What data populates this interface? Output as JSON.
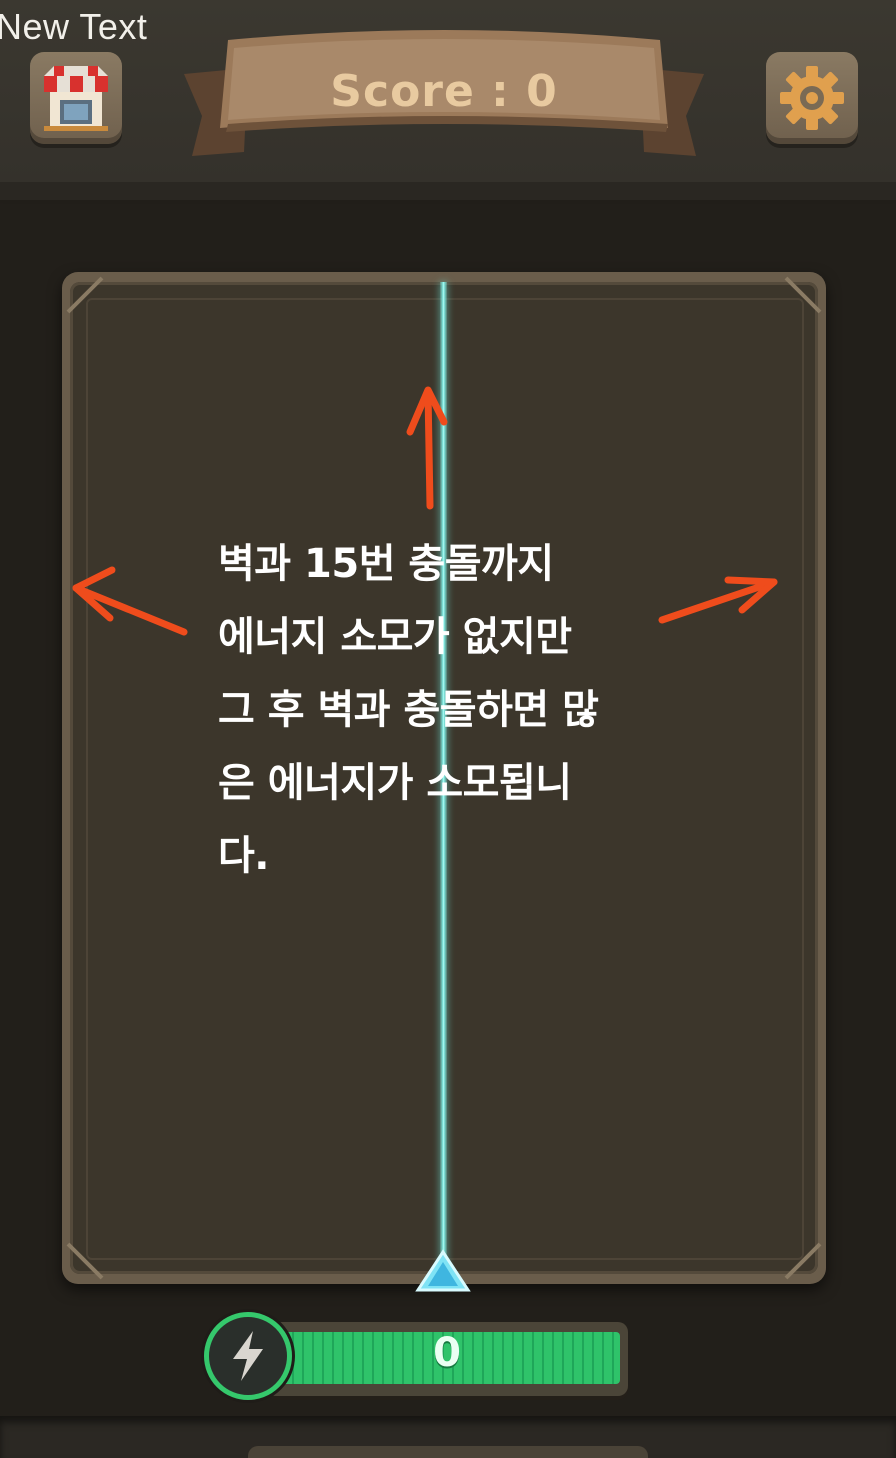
{
  "debug_label": "New Text",
  "score": {
    "text": "Score : 0"
  },
  "buttons": {
    "shop_icon": "shop-icon",
    "settings_icon": "gear-icon"
  },
  "board": {
    "hint_text": "벽과 15번 충돌까지\n에너지 소모가 없지만\n그 후 벽과 충돌하면 많\n은 에너지가 소모됩니\n다.",
    "arrow_color": "#ef4c1c",
    "aim_color": "#7fe7df"
  },
  "energy": {
    "icon": "lightning-icon",
    "value": "0",
    "fill_fraction": 1.0,
    "fill_color": "#2fc36a"
  }
}
